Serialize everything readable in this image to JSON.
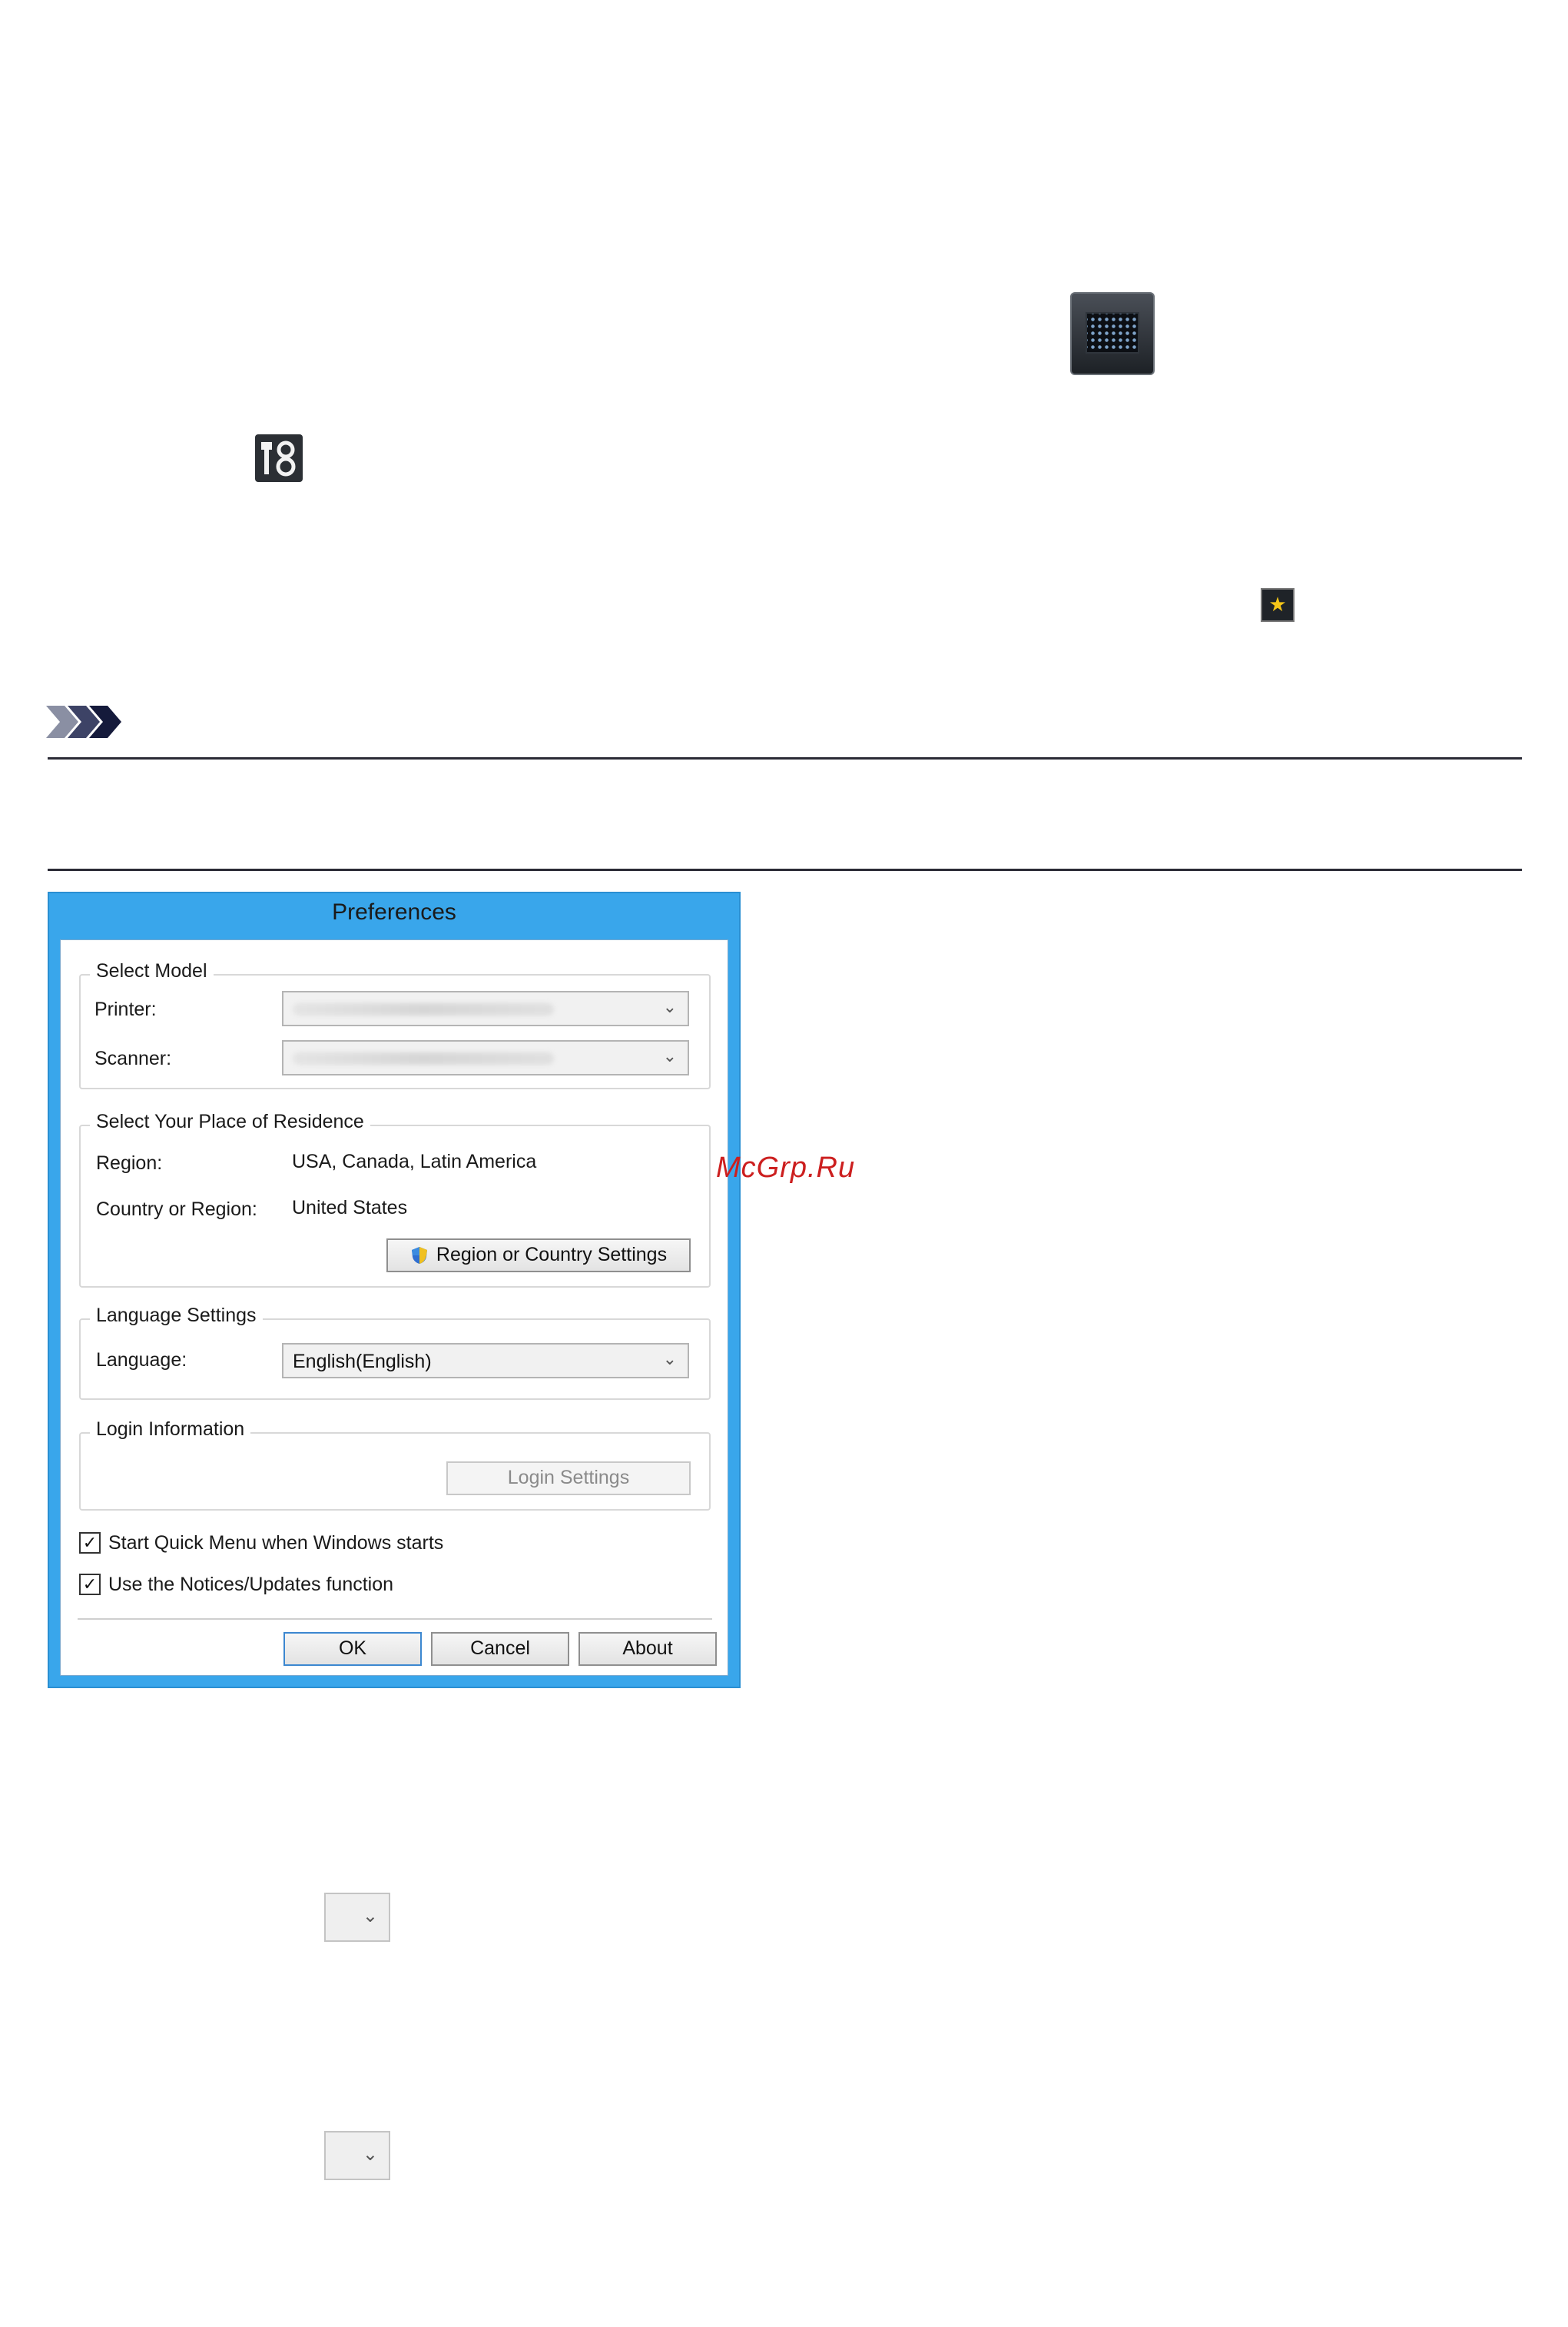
{
  "icons": {
    "apps": "all-apps-icon",
    "tools": "settings-tools-icon",
    "quick_menu": "quick-menu-icon",
    "note": "note-icon"
  },
  "dialog": {
    "title": "Preferences",
    "select_model": {
      "title": "Select Model",
      "printer_label": "Printer:",
      "scanner_label": "Scanner:"
    },
    "residence": {
      "title": "Select Your Place of Residence",
      "region_label": "Region:",
      "region_value": "USA, Canada, Latin America",
      "country_label": "Country or Region:",
      "country_value": "United States",
      "settings_button": "Region or Country Settings"
    },
    "language": {
      "title": "Language Settings",
      "label": "Language:",
      "value": "English(English)"
    },
    "login": {
      "title": "Login Information",
      "button": "Login Settings"
    },
    "checks": {
      "quick_menu_label": "Start Quick Menu when Windows starts",
      "quick_menu_checked": true,
      "notices_label": "Use the Notices/Updates function",
      "notices_checked": true
    },
    "buttons": {
      "ok": "OK",
      "cancel": "Cancel",
      "about": "About"
    }
  },
  "watermark": "McGrp.Ru",
  "colors": {
    "title_bar": "#39a6eb",
    "watermark": "#cc1f1f"
  }
}
